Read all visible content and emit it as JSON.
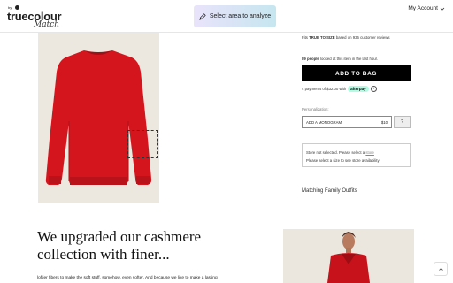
{
  "header": {
    "logo": {
      "by": "by",
      "word": "truecolour",
      "script": "Match"
    },
    "analyze_button": "Select area to analyze",
    "account": "My Account"
  },
  "product": {
    "fits_prefix": "Fits",
    "fits_bold": "TRUE TO SIZE",
    "fits_suffix": "based on 936 customer reviews",
    "viewers_bold": "89 people",
    "viewers_text": "looked at this item in the last hour.",
    "add_to_bag": "ADD TO BAG",
    "payments_text": "4 payments of $32.00 with",
    "afterpay": "afterpay",
    "personalization_label": "Personalization:",
    "monogram_label": "ADD A MONOGRAM",
    "monogram_price": "$10",
    "help": "?",
    "store_line1": "Store not selected. Please select a",
    "store_link": "store",
    "store_line2": "Please select a size to see store availability",
    "matching": "Matching Family Outfits"
  },
  "story": {
    "headline_line1": "We upgraded our cashmere",
    "headline_line2": "collection with finer...",
    "body": "loftier fibers to make the soft stuff, somehow, even softer. And because we like to make a lasting"
  },
  "colors": {
    "sweater": "#d4151e",
    "accent_gradient_start": "#e9e3fb",
    "accent_gradient_end": "#c6e6ef",
    "afterpay": "#b2fce4"
  },
  "icons": [
    "pen-select-icon",
    "chevron-down-icon",
    "info-icon",
    "arrow-up-icon"
  ]
}
